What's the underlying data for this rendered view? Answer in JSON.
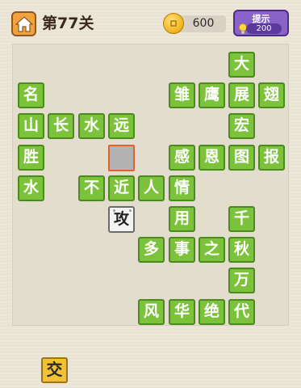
{
  "header": {
    "level_title": "第77关",
    "coins": "600",
    "hint_label": "提示",
    "hint_cost": "200"
  },
  "board": {
    "tiles": [
      {
        "ch": "大",
        "row": 0,
        "col": 7
      },
      {
        "ch": "名",
        "row": 1,
        "col": 0
      },
      {
        "ch": "雏",
        "row": 1,
        "col": 5
      },
      {
        "ch": "鹰",
        "row": 1,
        "col": 6
      },
      {
        "ch": "展",
        "row": 1,
        "col": 7
      },
      {
        "ch": "翅",
        "row": 1,
        "col": 8
      },
      {
        "ch": "山",
        "row": 2,
        "col": 0
      },
      {
        "ch": "长",
        "row": 2,
        "col": 1
      },
      {
        "ch": "水",
        "row": 2,
        "col": 2
      },
      {
        "ch": "远",
        "row": 2,
        "col": 3
      },
      {
        "ch": "宏",
        "row": 2,
        "col": 7
      },
      {
        "ch": "胜",
        "row": 3,
        "col": 0
      },
      {
        "ch": "感",
        "row": 3,
        "col": 5
      },
      {
        "ch": "恩",
        "row": 3,
        "col": 6
      },
      {
        "ch": "图",
        "row": 3,
        "col": 7
      },
      {
        "ch": "报",
        "row": 3,
        "col": 8
      },
      {
        "ch": "水",
        "row": 4,
        "col": 0
      },
      {
        "ch": "不",
        "row": 4,
        "col": 2
      },
      {
        "ch": "近",
        "row": 4,
        "col": 3
      },
      {
        "ch": "人",
        "row": 4,
        "col": 4
      },
      {
        "ch": "情",
        "row": 4,
        "col": 5
      },
      {
        "ch": "用",
        "row": 5,
        "col": 5
      },
      {
        "ch": "千",
        "row": 5,
        "col": 7
      },
      {
        "ch": "多",
        "row": 6,
        "col": 4
      },
      {
        "ch": "事",
        "row": 6,
        "col": 5
      },
      {
        "ch": "之",
        "row": 6,
        "col": 6
      },
      {
        "ch": "秋",
        "row": 6,
        "col": 7
      },
      {
        "ch": "万",
        "row": 7,
        "col": 7
      },
      {
        "ch": "风",
        "row": 8,
        "col": 4
      },
      {
        "ch": "华",
        "row": 8,
        "col": 5
      },
      {
        "ch": "绝",
        "row": 8,
        "col": 6
      },
      {
        "ch": "代",
        "row": 8,
        "col": 7
      }
    ],
    "empty_slot": {
      "row": 3,
      "col": 3
    },
    "placed_gray": {
      "ch": "攻",
      "row": 5,
      "col": 3
    }
  },
  "choices": [
    "交"
  ],
  "colors": {
    "tile_green": "#7cc23b",
    "slot_highlight": "#e4612a",
    "choice_yellow": "#f2c236",
    "hint_purple": "#8a63c9",
    "home_orange": "#f1a23e"
  },
  "icons": {
    "home": "home-icon",
    "coin": "coin-icon",
    "hint": "lightbulb-icon"
  }
}
